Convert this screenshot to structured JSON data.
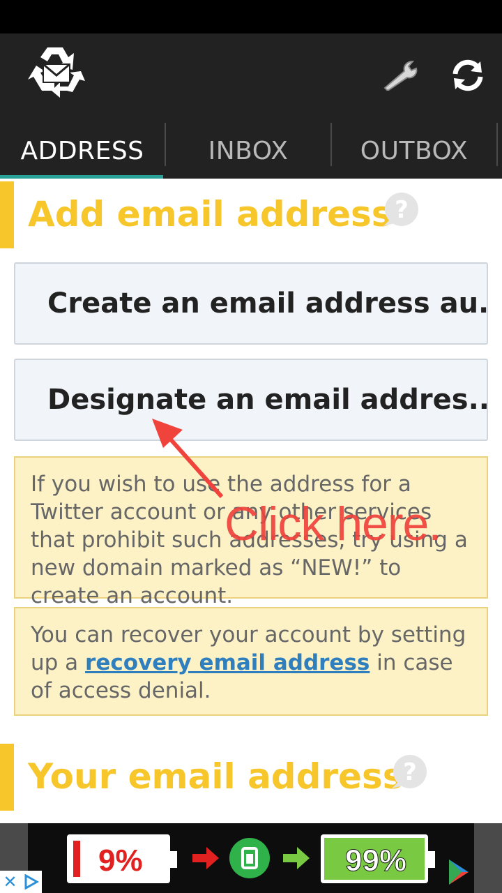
{
  "tabs": [
    {
      "label": "ADDRESS",
      "active": true
    },
    {
      "label": "INBOX",
      "active": false
    },
    {
      "label": "OUTBOX",
      "active": false
    }
  ],
  "toolbar": {
    "settings_icon": "wrench-icon",
    "refresh_icon": "refresh-icon",
    "logo_icon": "recycle-mail-icon"
  },
  "add_section": {
    "title": "Add email address",
    "create_button": "Create an email address au...",
    "designate_button": "Designate an email addres...",
    "twitter_note": "If you wish to use the address for a Twitter account or any other services that prohibit such addresses, try using a new domain marked as “NEW!” to create an account.",
    "recovery_note": {
      "before": "You can recover your account by setting up a ",
      "link": "recovery email address",
      "after": " in case of access denial."
    }
  },
  "your_section": {
    "title": "Your email address"
  },
  "annotation": {
    "text": "Click here."
  },
  "ad": {
    "low": "9%",
    "high": "99%",
    "close_glyph": "✕"
  },
  "colors": {
    "accent": "#f6c62b",
    "tab_indicator": "#2aa198",
    "appbar": "#222222",
    "annotation": "#f0433c"
  }
}
